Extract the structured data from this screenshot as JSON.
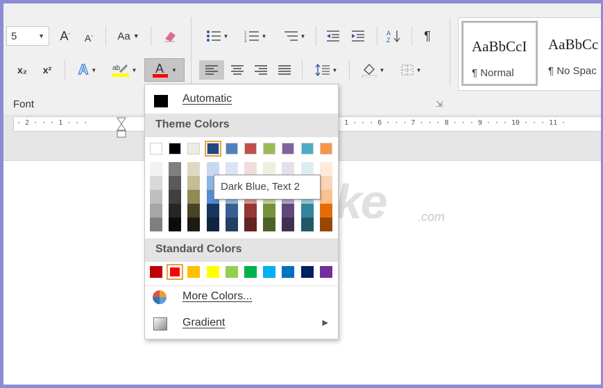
{
  "ribbon": {
    "font_size_partial": "5",
    "grow_font": "A",
    "shrink_font": "A",
    "change_case": "Aa",
    "subscript": "x₂",
    "superscript": "x²",
    "font_group_label": "Font"
  },
  "styles": [
    {
      "sample": "AaBbCcI",
      "name": "¶ Normal"
    },
    {
      "sample": "AaBbCc",
      "name": "¶ No Spac"
    }
  ],
  "ruler": {
    "left_text": "· 2 · · · 1 · · ·",
    "right_text": "· · 1 · · · 6 · · · 7 · · · 8 · · · 9 · · · 10 · · · 11 ·"
  },
  "color_menu": {
    "automatic_label": "Automatic",
    "theme_header": "Theme Colors",
    "standard_header": "Standard Colors",
    "more_colors_label": "More Colors...",
    "gradient_label": "Gradient",
    "tooltip": "Dark Blue, Text 2",
    "theme_colors": [
      "#ffffff",
      "#000000",
      "#eeece1",
      "#1f497d",
      "#4f81bd",
      "#c0504d",
      "#9bbb59",
      "#8064a2",
      "#4bacc6",
      "#f79646"
    ],
    "theme_shade_columns": [
      [
        "#f2f2f2",
        "#d9d9d9",
        "#bfbfbf",
        "#a6a6a6",
        "#7f7f7f"
      ],
      [
        "#7f7f7f",
        "#595959",
        "#3f3f3f",
        "#262626",
        "#0c0c0c"
      ],
      [
        "#ddd9c3",
        "#c4bd97",
        "#938953",
        "#494429",
        "#1d1b10"
      ],
      [
        "#c6d9f0",
        "#8db3e2",
        "#548dd4",
        "#17365d",
        "#0f243e"
      ],
      [
        "#dbe5f1",
        "#b8cce4",
        "#95b3d7",
        "#366092",
        "#244061"
      ],
      [
        "#f2dcdb",
        "#e5b9b7",
        "#d99694",
        "#953734",
        "#632423"
      ],
      [
        "#ebf1dd",
        "#d7e3bc",
        "#c3d69b",
        "#76923c",
        "#4f6128"
      ],
      [
        "#e5e0ec",
        "#ccc1d9",
        "#b2a2c7",
        "#5f497a",
        "#3f3151"
      ],
      [
        "#dbeef3",
        "#b7dde8",
        "#92cddc",
        "#31859b",
        "#205867"
      ],
      [
        "#fdeada",
        "#fbd5b5",
        "#fac08f",
        "#e36c09",
        "#974806"
      ]
    ],
    "standard_colors": [
      "#c00000",
      "#ff0000",
      "#ffc000",
      "#ffff00",
      "#92d050",
      "#00b050",
      "#00b0f0",
      "#0070c0",
      "#002060",
      "#7030a0"
    ],
    "highlighted_theme_index": 3,
    "highlighted_standard_index": 1
  },
  "watermark": {
    "text": "TipsMake",
    "suffix": ".com"
  }
}
